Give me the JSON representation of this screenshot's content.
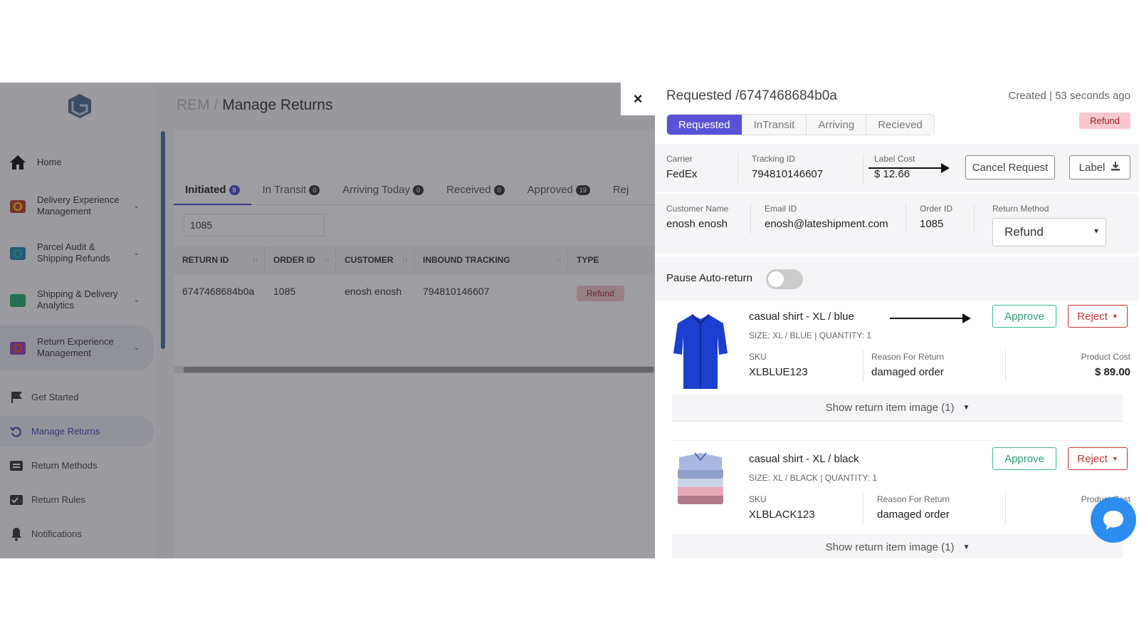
{
  "sidebar": {
    "items": [
      {
        "label": "Home",
        "icon": "home-icon"
      },
      {
        "label": "Delivery Experience Management",
        "icon": "delivery-icon"
      },
      {
        "label": "Parcel Audit & Shipping Refunds",
        "icon": "parcel-icon"
      },
      {
        "label": "Shipping & Delivery Analytics",
        "icon": "analytics-icon"
      },
      {
        "label": "Return Experience Management",
        "icon": "return-icon"
      }
    ],
    "subitems": [
      {
        "label": "Get Started",
        "icon": "flag-icon"
      },
      {
        "label": "Manage Returns",
        "icon": "return-arrow-icon"
      },
      {
        "label": "Return Methods",
        "icon": "list-icon"
      },
      {
        "label": "Return Rules",
        "icon": "checklist-icon"
      },
      {
        "label": "Notifications",
        "icon": "bell-icon"
      }
    ]
  },
  "breadcrumb": {
    "root": "REM",
    "sep": "/",
    "page": "Manage Returns"
  },
  "tabs": [
    {
      "label": "Initiated",
      "count": "9"
    },
    {
      "label": "In Transit",
      "count": "0"
    },
    {
      "label": "Arriving Today",
      "count": "0"
    },
    {
      "label": "Received",
      "count": "0"
    },
    {
      "label": "Approved",
      "count": "19"
    },
    {
      "label": "Rej"
    }
  ],
  "search": {
    "value": "1085"
  },
  "table": {
    "headers": [
      "RETURN ID",
      "ORDER ID",
      "CUSTOMER",
      "INBOUND TRACKING",
      "TYPE"
    ],
    "rows": [
      [
        "6747468684b0a",
        "1085",
        "enosh enosh",
        "794810146607",
        "Refund"
      ]
    ]
  },
  "drawer": {
    "close": "×",
    "title": "Requested /6747468684b0a",
    "created": "Created | 53 seconds ago",
    "type_badge": "Refund",
    "statuses": [
      "Requested",
      "InTransit",
      "Arriving",
      "Recieved"
    ],
    "carrier_label": "Carrier",
    "carrier": "FedEx",
    "tracking_label": "Tracking ID",
    "tracking": "794810146607",
    "labelcost_label": "Label Cost",
    "labelcost": "$ 12.66",
    "cancel_btn": "Cancel Request",
    "label_btn": "Label",
    "customer_label": "Customer Name",
    "customer": "enosh enosh",
    "email_label": "Email ID",
    "email": "enosh@lateshipment.com",
    "order_label": "Order ID",
    "order": "1085",
    "method_label": "Return Method",
    "method": "Refund",
    "pause_label": "Pause Auto-return",
    "items": [
      {
        "name": "casual shirt - XL / blue",
        "size": "SIZE: XL / BLUE | QUANTITY: 1",
        "sku_label": "SKU",
        "sku": "XLBLUE123",
        "reason_label": "Reason For Return",
        "reason": "damaged order",
        "cost_label": "Product Cost",
        "cost": "$ 89.00",
        "approve": "Approve",
        "reject": "Reject",
        "show_image": "Show return item image (1)"
      },
      {
        "name": "casual shirt - XL / black",
        "size": "SIZE: XL / BLACK | QUANTITY: 1",
        "sku_label": "SKU",
        "sku": "XLBLACK123",
        "reason_label": "Reason For Return",
        "reason": "damaged order",
        "cost_label": "Product Cost",
        "approve": "Approve",
        "reject": "Reject",
        "show_image": "Show return item image (1)"
      }
    ]
  },
  "colors": {
    "accent": "#5a52d6",
    "approve": "#2a9c6e",
    "reject": "#cc3333",
    "chat": "#2d8cf0"
  }
}
